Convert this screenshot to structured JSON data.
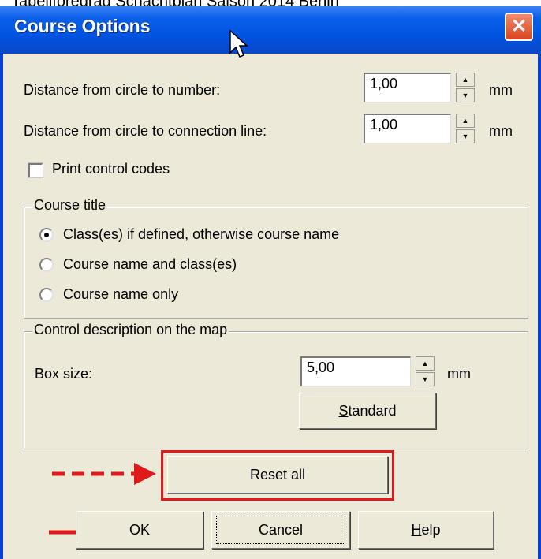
{
  "caption": "Tabellforedrag Schachtplan Saison 2014 Berlin",
  "window": {
    "title": "Course Options",
    "close_glyph": "✕"
  },
  "fields": {
    "distance_number": {
      "label": "Distance from circle to number:",
      "value": "1,00",
      "unit": "mm"
    },
    "distance_line": {
      "label": "Distance from circle to connection line:",
      "value": "1,00",
      "unit": "mm"
    },
    "print_codes": {
      "label": "Print control codes",
      "checked": false
    }
  },
  "course_title": {
    "legend": "Course title",
    "options": [
      {
        "label": "Class(es) if defined, otherwise course name",
        "selected": true
      },
      {
        "label": "Course name and class(es)",
        "selected": false
      },
      {
        "label": "Course name only",
        "selected": false
      }
    ]
  },
  "control_description": {
    "legend": "Control description on the map",
    "box_size_label": "Box size:",
    "box_size_value": "5,00",
    "box_size_unit": "mm",
    "standard_button": {
      "mnemonic": "S",
      "rest": "tandard"
    }
  },
  "buttons": {
    "reset": "Reset all",
    "ok": "OK",
    "cancel": "Cancel",
    "help": {
      "mnemonic": "H",
      "rest": "elp"
    }
  },
  "colors": {
    "titlebar": "#0054e3",
    "dialog_bg": "#ece9d8",
    "annotation_red": "#e01a1a"
  },
  "icons": {
    "close": "close-icon",
    "cursor": "mouse-cursor-icon",
    "spin_up": "spin-up-icon",
    "spin_down": "spin-down-icon"
  }
}
